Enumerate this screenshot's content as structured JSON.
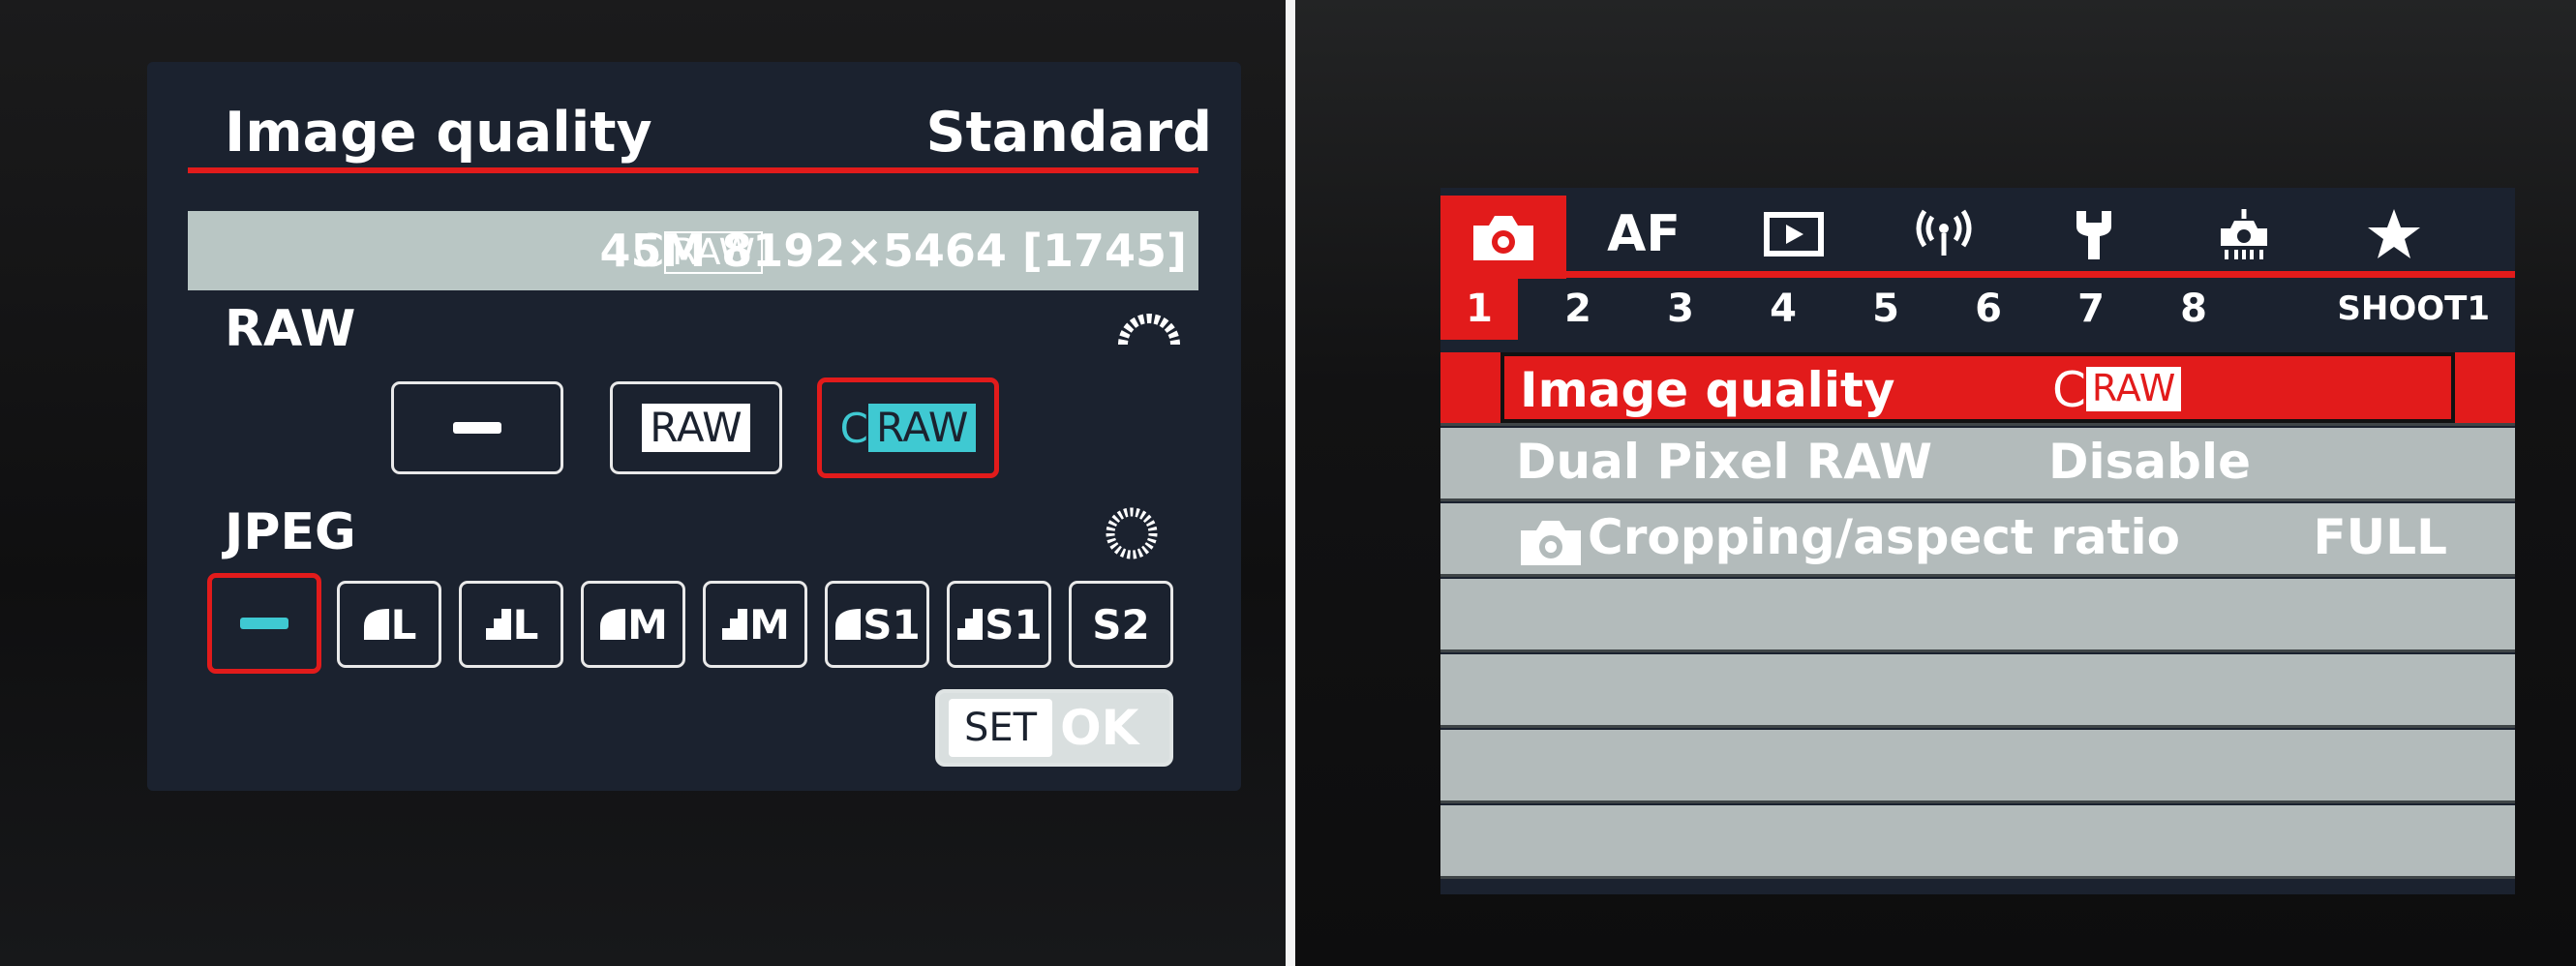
{
  "left_screen": {
    "title": "Image quality",
    "mode": "Standard",
    "info": {
      "craw_prefix": "C",
      "craw_box": "RAW",
      "text": "45M 8192×5464 [1745]"
    },
    "raw_section_label": "RAW",
    "raw_options": [
      {
        "id": "none",
        "label": ""
      },
      {
        "id": "raw",
        "label": "RAW"
      },
      {
        "id": "craw",
        "prefix": "C",
        "box": "RAW"
      }
    ],
    "jpeg_section_label": "JPEG",
    "jpeg_options": [
      "",
      "L",
      "L",
      "M",
      "M",
      "S1",
      "S1",
      "S2"
    ],
    "set_label": "SET",
    "ok_label": "OK",
    "accent": "#e21b1b",
    "selection_color": "#3fc9d2"
  },
  "right_screen": {
    "tabs": [
      "camera-icon",
      "AF",
      "playback-icon",
      "wireless-icon",
      "wrench-icon",
      "custom-icon",
      "star-icon"
    ],
    "tab_af_label": "AF",
    "subtabs": [
      "1",
      "2",
      "3",
      "4",
      "5",
      "6",
      "7",
      "8"
    ],
    "shoot_label": "SHOOT1",
    "menu": [
      {
        "label": "Image quality",
        "value_prefix": "C",
        "value_box": "RAW"
      },
      {
        "label": "Dual Pixel RAW",
        "value": "Disable"
      },
      {
        "label": "Cropping/aspect ratio",
        "value": "FULL"
      }
    ]
  }
}
